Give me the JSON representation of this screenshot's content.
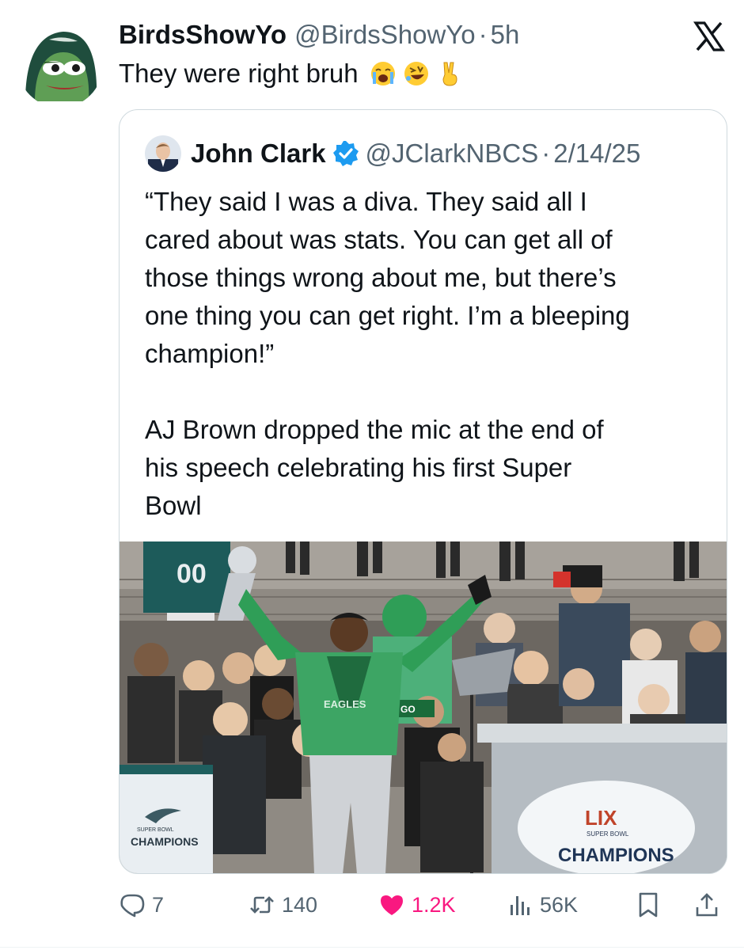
{
  "tweet": {
    "display_name": "BirdsShowYo",
    "handle": "@BirdsShowYo",
    "separator": "·",
    "time": "5h",
    "text": "They were right bruh",
    "emojis": [
      "loudly-crying-face",
      "rolling-on-floor-laughing",
      "victory-hand"
    ]
  },
  "quote": {
    "display_name": "John Clark",
    "verified": true,
    "handle": "@JClarkNBCS",
    "separator": "·",
    "date": "2/14/25",
    "paragraph_1": "“They said I was a diva. They said all I\ncared about was stats. You can get all of\nthose things wrong about me, but there’s\none thing you can get right. I’m a bleeping\nchampion!”",
    "paragraph_2": "AJ Brown dropped the mic at the end of\nhis speech celebrating his first Super\nBowl",
    "photo": {
      "jersey_number": "00",
      "hoodie_text": "EAGLES",
      "hat_text": "GO",
      "left_sign_small": "SUPER BOWL",
      "left_sign": "CHAMPIONS",
      "podium_logo": "LIX",
      "podium_small": "SUPER BOWL",
      "podium_text": "CHAMPIONS"
    }
  },
  "actions": {
    "replies": "7",
    "reposts": "140",
    "likes": "1.2K",
    "views": "56K"
  },
  "colors": {
    "text": "#0f1419",
    "secondary": "#536471",
    "border": "#cfd9de",
    "like": "#f91880",
    "verified": "#1d9bf0",
    "eagles_green": "#2a8c52"
  },
  "icons": [
    "x-logo-icon",
    "verified-badge-icon",
    "reply-icon",
    "repost-icon",
    "like-icon",
    "views-icon",
    "bookmark-icon",
    "share-icon"
  ]
}
